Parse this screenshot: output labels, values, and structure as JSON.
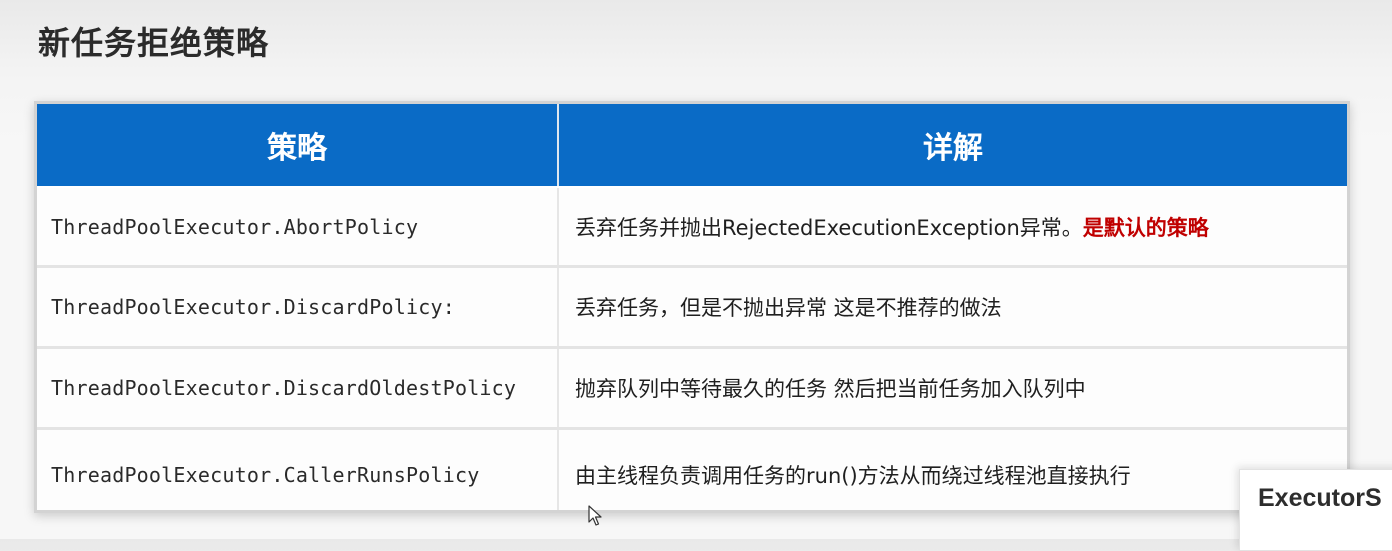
{
  "title": "新任务拒绝策略",
  "table": {
    "headers": [
      "策略",
      "详解"
    ],
    "rows": [
      {
        "policy": "ThreadPoolExecutor.AbortPolicy",
        "detail": "丢弃任务并抛出RejectedExecutionException异常。",
        "highlight": "是默认的策略"
      },
      {
        "policy": "ThreadPoolExecutor.DiscardPolicy:",
        "detail": "丢弃任务，但是不抛出异常 这是不推荐的做法"
      },
      {
        "policy": "ThreadPoolExecutor.DiscardOldestPolicy",
        "detail": "抛弃队列中等待最久的任务 然后把当前任务加入队列中"
      },
      {
        "policy": "ThreadPoolExecutor.CallerRunsPolicy",
        "detail": "由主线程负责调用任务的run()方法从而绕过线程池直接执行"
      }
    ]
  },
  "next_card": {
    "text": "ExecutorS"
  },
  "colors": {
    "header_bg": "#0a6bc6",
    "highlight": "#c00000"
  },
  "icons": {
    "cursor": "mouse-pointer-icon"
  }
}
